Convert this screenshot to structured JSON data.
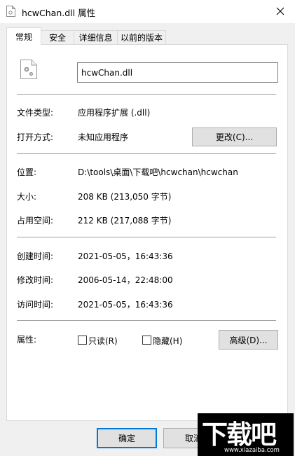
{
  "window": {
    "title": "hcwChan.dll 属性",
    "close_icon": "close-icon"
  },
  "tabs": [
    {
      "label": "常规",
      "active": true
    },
    {
      "label": "安全"
    },
    {
      "label": "详细信息"
    },
    {
      "label": "以前的版本"
    }
  ],
  "general": {
    "file_name": "hcwChan.dll",
    "file_icon": "dll-file-icon",
    "file_type_label": "文件类型:",
    "file_type_value": "应用程序扩展 (.dll)",
    "opens_with_label": "打开方式:",
    "opens_with_value": "未知应用程序",
    "change_button": "更改(C)...",
    "location_label": "位置:",
    "location_value": "D:\\tools\\桌面\\下载吧\\hcwchan\\hcwchan",
    "size_label": "大小:",
    "size_value": "208 KB (213,050 字节)",
    "size_on_disk_label": "占用空间:",
    "size_on_disk_value": "212 KB (217,088 字节)",
    "created_label": "创建时间:",
    "created_value": "2021-05-05，16:43:36",
    "modified_label": "修改时间:",
    "modified_value": "2006-05-14，22:48:00",
    "accessed_label": "访问时间:",
    "accessed_value": "2021-05-05，16:43:36",
    "attributes_label": "属性:",
    "readonly_label": "只读(R)",
    "readonly_checked": false,
    "hidden_label": "隐藏(H)",
    "hidden_checked": false,
    "advanced_button": "高级(D)..."
  },
  "footer": {
    "ok_button": "确定",
    "cancel_button": "取消"
  },
  "watermark": {
    "text": "下载吧",
    "url": "www.xiazaiba.com"
  }
}
